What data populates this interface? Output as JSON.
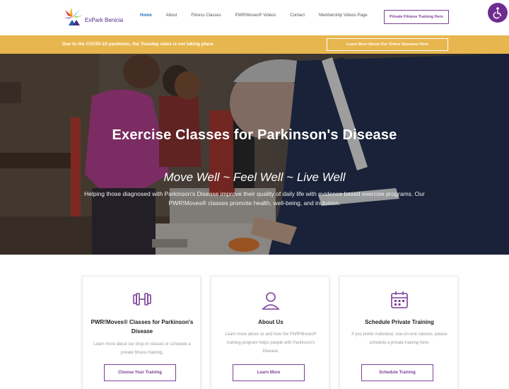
{
  "header": {
    "logo_text": "ExPark Benicia",
    "nav": [
      "Home",
      "About",
      "Fitness Classes",
      "PWR!Moves® Videos",
      "Contact",
      "Membership Videos Page"
    ],
    "private_button": "Private Fitness Training Here"
  },
  "banner": {
    "text": "Due to the COVID-19 pandemic, the Tuesday class is not taking place.",
    "button": "Learn More About Our Online Sessions Here"
  },
  "hero": {
    "title": "Exercise Classes for Parkinson's Disease",
    "tagline": "Move Well ~ Feel Well ~ Live Well",
    "description": "Helping those diagnosed with Parkinson's Disease improve their quality of daily life with evidence based exercise programs. Our PWR!Moves® classes promote health, well-being, and inclusion."
  },
  "cards": [
    {
      "icon": "dumbbell-icon",
      "title": "PWR!Moves® Classes for Parkinson's Disease",
      "description": "Learn more about our drop-in classes or schedule a private fitness training.",
      "button": "Choose Your Training"
    },
    {
      "icon": "user-icon",
      "title": "About Us",
      "description": "Learn more about us and how the PWR!Moves® training program helps people with Parkinson's Disease.",
      "button": "Learn More"
    },
    {
      "icon": "calendar-icon",
      "title": "Schedule Private Training",
      "description": "If you prefer individual, one-on-one classes, please schedule a private training here.",
      "button": "Schedule Training"
    }
  ],
  "colors": {
    "accent_purple": "#7c3f98",
    "banner_gold": "#e8b64e",
    "nav_active": "#1e73be"
  }
}
